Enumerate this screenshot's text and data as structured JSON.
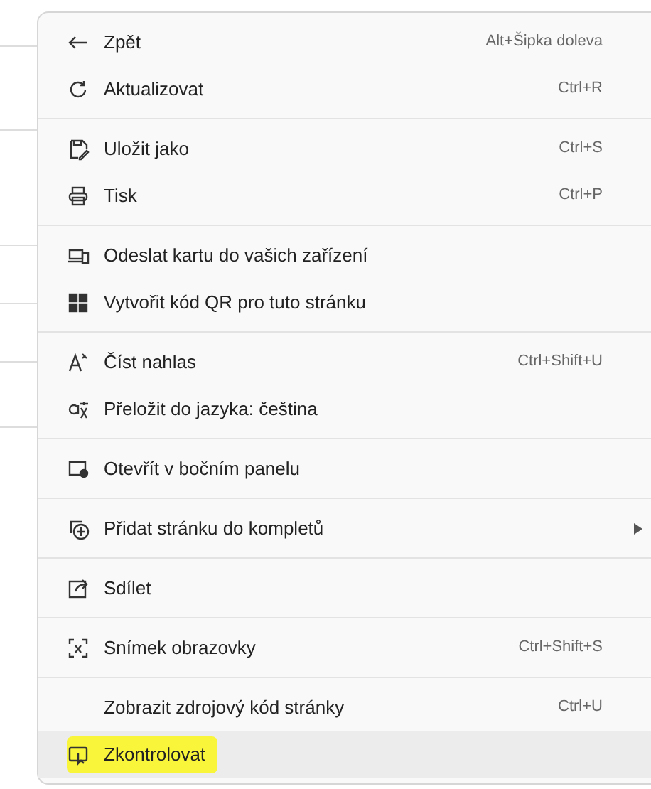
{
  "menu": {
    "groups": [
      {
        "items": [
          {
            "label": "Zpět",
            "shortcut": "Alt+Šipka doleva",
            "selected": false,
            "highlighted": false
          },
          {
            "label": "Aktualizovat",
            "shortcut": "Ctrl+R",
            "selected": false,
            "highlighted": false
          }
        ]
      },
      {
        "items": [
          {
            "label": "Uložit jako",
            "shortcut": "Ctrl+S",
            "selected": false,
            "highlighted": false
          },
          {
            "label": "Tisk",
            "shortcut": "Ctrl+P",
            "selected": false,
            "highlighted": false
          }
        ]
      },
      {
        "items": [
          {
            "label": "Odeslat kartu do vašich zařízení",
            "selected": false,
            "highlighted": false
          },
          {
            "label": "Vytvořit kód QR pro tuto stránku",
            "selected": false,
            "highlighted": false
          }
        ]
      },
      {
        "items": [
          {
            "label": "Číst nahlas",
            "shortcut": "Ctrl+Shift+U",
            "selected": false,
            "highlighted": false
          },
          {
            "label": "Přeložit do jazyka: čeština",
            "selected": false,
            "highlighted": false
          }
        ]
      },
      {
        "items": [
          {
            "label": "Otevřít v bočním panelu",
            "selected": false,
            "highlighted": false
          }
        ]
      },
      {
        "items": [
          {
            "label": "Přidat stránku do kompletů",
            "submenu": true,
            "selected": false,
            "highlighted": false
          }
        ]
      },
      {
        "items": [
          {
            "label": "Sdílet",
            "selected": false,
            "highlighted": false
          }
        ]
      },
      {
        "items": [
          {
            "label": "Snímek obrazovky",
            "shortcut": "Ctrl+Shift+S",
            "selected": false,
            "highlighted": false
          }
        ]
      },
      {
        "items": [
          {
            "label": "Zobrazit zdrojový kód stránky",
            "shortcut": "Ctrl+U",
            "selected": false,
            "highlighted": false
          },
          {
            "label": "Zkontrolovat",
            "selected": true,
            "highlighted": true
          }
        ]
      }
    ]
  }
}
